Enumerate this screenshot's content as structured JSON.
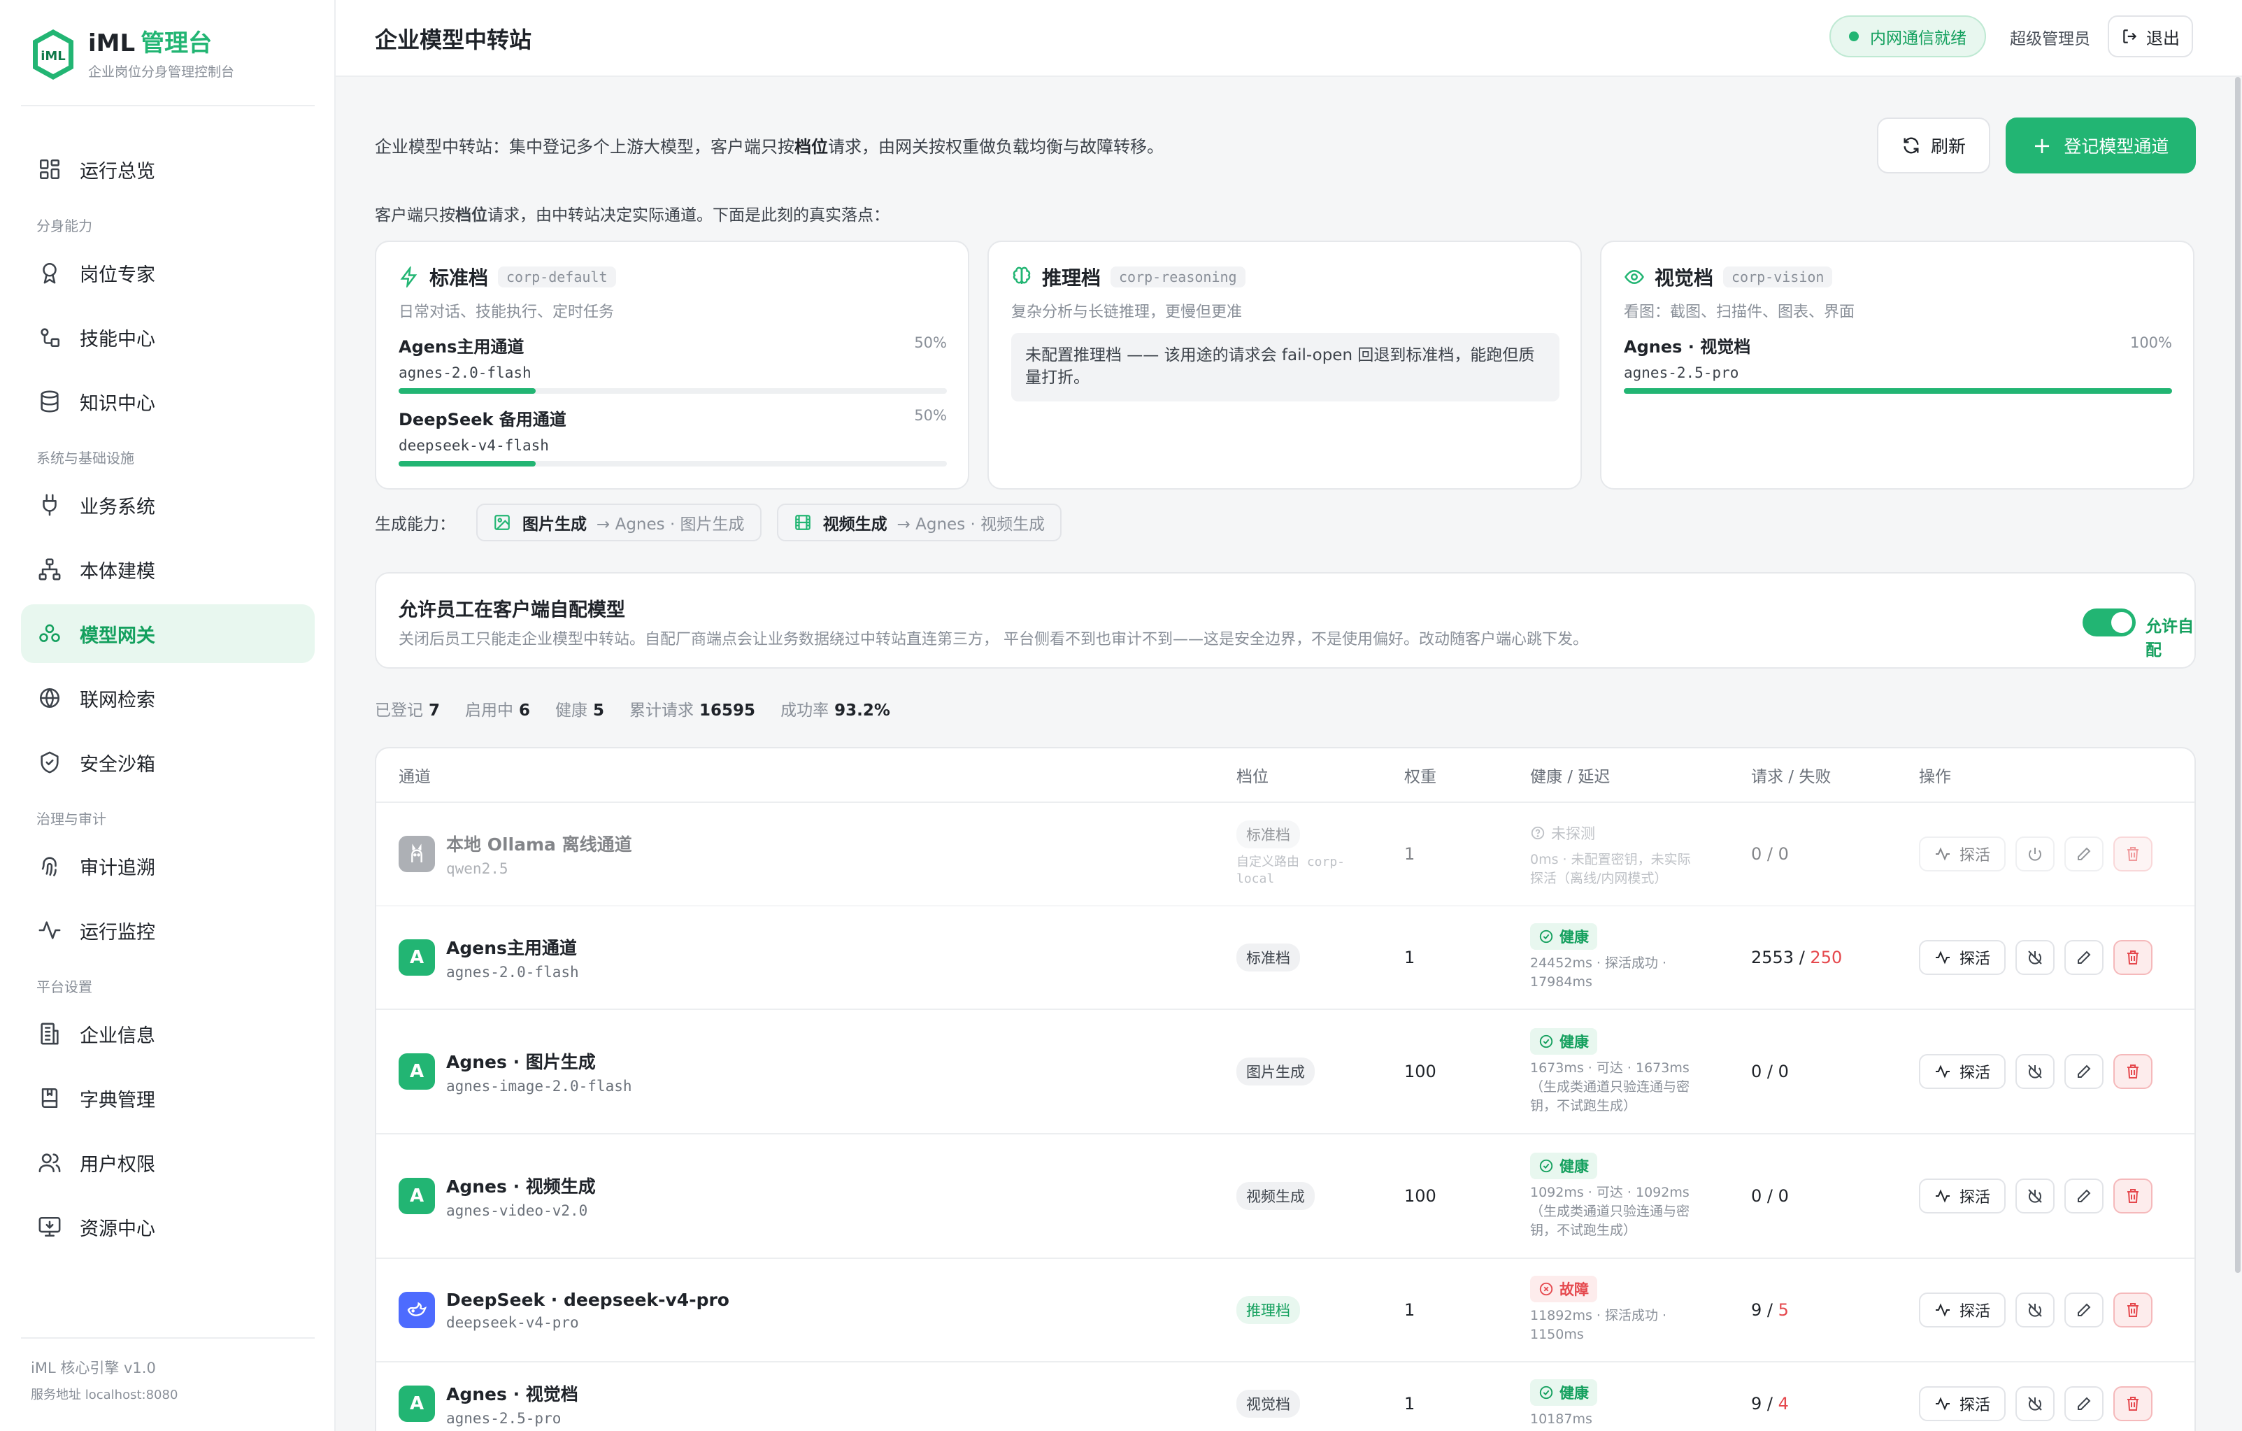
{
  "brand": {
    "title_main": "iML",
    "title_accent": "管理台",
    "subtitle": "企业岗位分身管理控制台",
    "logo_text": "iML"
  },
  "sidebar": {
    "items": [
      {
        "label": "运行总览",
        "icon": "dashboard-icon",
        "active": false
      },
      {
        "group": "分身能力"
      },
      {
        "label": "岗位专家",
        "icon": "award-icon",
        "active": false
      },
      {
        "label": "技能中心",
        "icon": "skills-icon",
        "active": false
      },
      {
        "label": "知识中心",
        "icon": "database-icon",
        "active": false
      },
      {
        "group": "系统与基础设施"
      },
      {
        "label": "业务系统",
        "icon": "plug-icon",
        "active": false
      },
      {
        "label": "本体建模",
        "icon": "hierarchy-icon",
        "active": false
      },
      {
        "label": "模型网关",
        "icon": "cluster-icon",
        "active": true
      },
      {
        "label": "联网检索",
        "icon": "globe-icon",
        "active": false
      },
      {
        "label": "安全沙箱",
        "icon": "shield-icon",
        "active": false
      },
      {
        "group": "治理与审计"
      },
      {
        "label": "审计追溯",
        "icon": "fingerprint-icon",
        "active": false
      },
      {
        "label": "运行监控",
        "icon": "activity-icon",
        "active": false
      },
      {
        "group": "平台设置"
      },
      {
        "label": "企业信息",
        "icon": "building-icon",
        "active": false
      },
      {
        "label": "字典管理",
        "icon": "book-icon",
        "active": false
      },
      {
        "label": "用户权限",
        "icon": "users-icon",
        "active": false
      },
      {
        "label": "资源中心",
        "icon": "monitor-icon",
        "active": false
      }
    ],
    "footer_version": "iML 核心引擎 v1.0",
    "footer_address": "服务地址 localhost:8080"
  },
  "topbar": {
    "title": "企业模型中转站",
    "status": "内网通信就绪",
    "user": "超级管理员",
    "logout": "退出"
  },
  "main": {
    "intro_prefix": "企业模型中转站：集中登记多个上游大模型，客户端只按",
    "intro_bold": "档位",
    "intro_suffix": "请求，由网关按权重做负载均衡与故障转移。",
    "refresh_label": "刷新",
    "register_label": "登记模型通道",
    "tier_intro_prefix": "客户端只按",
    "tier_intro_bold": "档位",
    "tier_intro_suffix": "请求，由中转站决定实际通道。下面是此刻的真实落点：",
    "tiers": [
      {
        "name": "标准档",
        "code": "corp-default",
        "desc": "日常对话、技能执行、定时任务",
        "routes": [
          {
            "name": "Agens主用通道",
            "model": "agnes-2.0-flash",
            "pct": "50%",
            "share": 0.5
          },
          {
            "name": "DeepSeek 备用通道",
            "model": "deepseek-v4-flash",
            "pct": "50%",
            "share": 0.5
          }
        ]
      },
      {
        "name": "推理档",
        "code": "corp-reasoning",
        "desc": "复杂分析与长链推理，更慢但更准",
        "note": "未配置推理档 —— 该用途的请求会 fail-open 回退到标准档，能跑但质量打折。"
      },
      {
        "name": "视觉档",
        "code": "corp-vision",
        "desc": "看图：截图、扫描件、图表、界面",
        "routes": [
          {
            "name": "Agnes · 视觉档",
            "model": "agnes-2.5-pro",
            "pct": "100%",
            "share": 1.0
          }
        ]
      }
    ],
    "gen_label": "生成能力：",
    "gen_chips": [
      {
        "name": "图片生成",
        "target": "→ Agnes · 图片生成"
      },
      {
        "name": "视频生成",
        "target": "→ Agnes · 视频生成"
      }
    ],
    "allow": {
      "title": "允许员工在客户端自配模型",
      "desc": "关闭后员工只能走企业模型中转站。自配厂商端点会让业务数据绕过中转站直连第三方， 平台侧看不到也审计不到——这是安全边界，不是使用偏好。改动随客户端心跳下发。",
      "toggle_label": "允许自配",
      "enabled": true
    },
    "stats": [
      {
        "label": "已登记",
        "value": "7"
      },
      {
        "label": "启用中",
        "value": "6"
      },
      {
        "label": "健康",
        "value": "5"
      },
      {
        "label": "累计请求",
        "value": "16595"
      },
      {
        "label": "成功率",
        "value": "93.2%"
      }
    ]
  },
  "table": {
    "headers": [
      "通道",
      "档位",
      "权重",
      "健康 / 延迟",
      "请求 / 失败",
      "操作"
    ],
    "probe_label": "探活",
    "rows": [
      {
        "avatar": "ollama",
        "name": "本地 Ollama 离线通道",
        "model": "qwen2.5",
        "tier": "标准档",
        "tier_sub": "自定义路由 corp-local",
        "weight": "1",
        "health": "未探测",
        "health_type": "none",
        "detail": "0ms · 未配置密钥，未实际探活（离线/内网模式）",
        "req": "0",
        "fail": "0",
        "fail_red": false,
        "dim": true
      },
      {
        "avatar": "A",
        "name": "Agens主用通道",
        "model": "agnes-2.0-flash",
        "tier": "标准档",
        "tier_sub": "",
        "weight": "1",
        "health": "健康",
        "health_type": "ok",
        "detail": "24452ms · 探活成功 · 17984ms",
        "req": "2553",
        "fail": "250",
        "fail_red": true,
        "dim": false
      },
      {
        "avatar": "A",
        "name": "Agnes · 图片生成",
        "model": "agnes-image-2.0-flash",
        "tier": "图片生成",
        "tier_sub": "",
        "weight": "100",
        "health": "健康",
        "health_type": "ok",
        "detail": "1673ms · 可达 · 1673ms（生成类通道只验连通与密钥，不试跑生成）",
        "req": "0",
        "fail": "0",
        "fail_red": false,
        "dim": false
      },
      {
        "avatar": "A",
        "name": "Agnes · 视频生成",
        "model": "agnes-video-v2.0",
        "tier": "视频生成",
        "tier_sub": "",
        "weight": "100",
        "health": "健康",
        "health_type": "ok",
        "detail": "1092ms · 可达 · 1092ms（生成类通道只验连通与密钥，不试跑生成）",
        "req": "0",
        "fail": "0",
        "fail_red": false,
        "dim": false
      },
      {
        "avatar": "deepseek",
        "name": "DeepSeek · deepseek-v4-pro",
        "model": "deepseek-v4-pro",
        "tier": "推理档",
        "tier_sub": "",
        "weight": "1",
        "health": "故障",
        "health_type": "bad",
        "detail": "11892ms · 探活成功 · 1150ms",
        "req": "9",
        "fail": "5",
        "fail_red": true,
        "dim": false
      },
      {
        "avatar": "A",
        "name": "Agnes · 视觉档",
        "model": "agnes-2.5-pro",
        "tier": "视觉档",
        "tier_sub": "",
        "weight": "1",
        "health": "健康",
        "health_type": "ok",
        "detail": "10187ms",
        "req": "9",
        "fail": "4",
        "fail_red": true,
        "dim": false
      }
    ]
  }
}
